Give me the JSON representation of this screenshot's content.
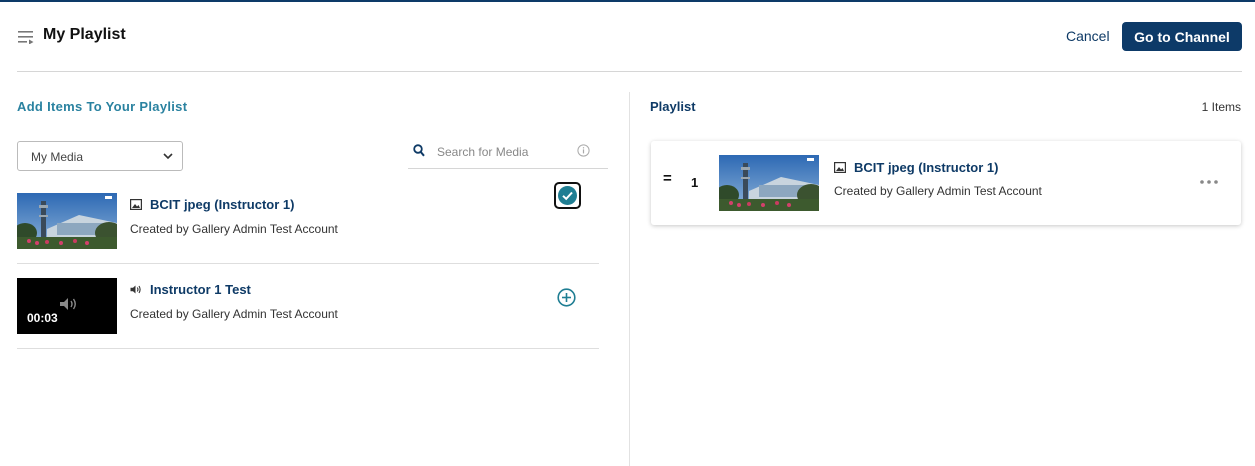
{
  "header": {
    "title": "My Playlist",
    "cancel_label": "Cancel",
    "go_label": "Go to Channel"
  },
  "left": {
    "section_title": "Add Items To Your Playlist",
    "media_filter": "My Media",
    "search_placeholder": "Search for Media",
    "items": [
      {
        "name": "BCIT jpeg (Instructor 1)",
        "meta": "Created by Gallery Admin Test Account",
        "type_icon": "image-icon",
        "state": "added"
      },
      {
        "name": "Instructor 1 Test",
        "meta": "Created by Gallery Admin Test Account",
        "type_icon": "audio-icon",
        "duration": "00:03",
        "state": "not-added"
      }
    ]
  },
  "right": {
    "section_title": "Playlist",
    "count": "1 Items",
    "items": [
      {
        "drag": "=",
        "index": "1",
        "name": "BCIT jpeg (Instructor 1)",
        "meta": "Created by Gallery Admin Test Account",
        "type_icon": "image-icon"
      }
    ]
  },
  "colors": {
    "accent": "#0d3a68",
    "section_teal": "#2a82a0",
    "check_teal": "#1f7e93"
  }
}
